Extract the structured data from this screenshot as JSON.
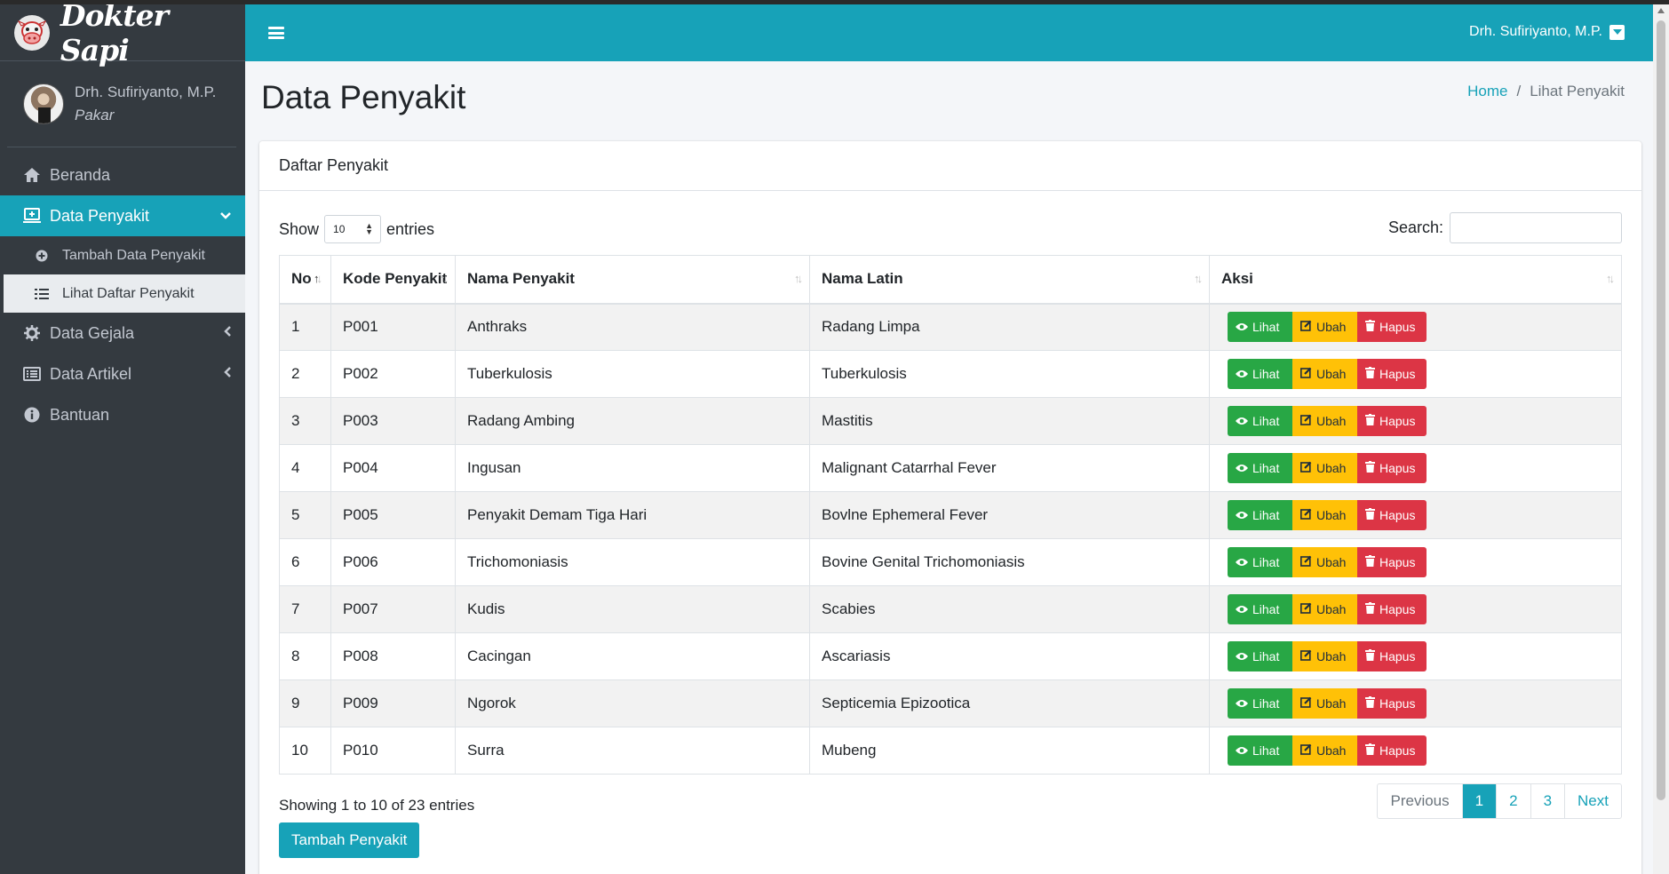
{
  "brand": {
    "name": "Dokter Sapi"
  },
  "user": {
    "name": "Drh. Sufiriyanto, M.P.",
    "role": "Pakar"
  },
  "sidebar": {
    "items": [
      {
        "label": "Beranda",
        "icon": "home-icon"
      },
      {
        "label": "Data Penyakit",
        "icon": "add-box-icon",
        "active": true
      },
      {
        "label": "Data Gejala",
        "icon": "gear-icon"
      },
      {
        "label": "Data Artikel",
        "icon": "list-alt-icon"
      },
      {
        "label": "Bantuan",
        "icon": "info-icon"
      }
    ],
    "sub_items": [
      {
        "label": "Tambah Data Penyakit",
        "icon": "plus-circle-icon"
      },
      {
        "label": "Lihat Daftar Penyakit",
        "icon": "list-icon",
        "current": true
      }
    ]
  },
  "header": {
    "user_label": "Drh. Sufiriyanto, M.P."
  },
  "page": {
    "title": "Data Penyakit",
    "breadcrumb": {
      "home": "Home",
      "sep": "/",
      "current": "Lihat Penyakit"
    }
  },
  "card": {
    "title": "Daftar Penyakit"
  },
  "controls": {
    "show": "Show",
    "entries_value": "10",
    "entries": "entries",
    "search_label": "Search:"
  },
  "table": {
    "columns": [
      "No",
      "Kode Penyakit",
      "Nama Penyakit",
      "Nama Latin",
      "Aksi"
    ],
    "rows": [
      [
        "1",
        "P001",
        "Anthraks",
        "Radang Limpa"
      ],
      [
        "2",
        "P002",
        "Tuberkulosis",
        "Tuberkulosis"
      ],
      [
        "3",
        "P003",
        "Radang Ambing",
        "Mastitis"
      ],
      [
        "4",
        "P004",
        "Ingusan",
        "Malignant Catarrhal Fever"
      ],
      [
        "5",
        "P005",
        "Penyakit Demam Tiga Hari",
        "Bovlne Ephemeral Fever"
      ],
      [
        "6",
        "P006",
        "Trichomoniasis",
        "Bovine Genital Trichomoniasis"
      ],
      [
        "7",
        "P007",
        "Kudis",
        "Scabies"
      ],
      [
        "8",
        "P008",
        "Cacingan",
        "Ascariasis"
      ],
      [
        "9",
        "P009",
        "Ngorok",
        "Septicemia Epizootica"
      ],
      [
        "10",
        "P010",
        "Surra",
        "Mubeng"
      ]
    ],
    "actions": {
      "view": "Lihat",
      "edit": "Ubah",
      "delete": "Hapus"
    }
  },
  "footer": {
    "info": "Showing 1 to 10 of 23 entries",
    "pager": [
      "Previous",
      "1",
      "2",
      "3",
      "Next"
    ],
    "current_page": "1",
    "add_button": "Tambah Penyakit"
  },
  "colors": {
    "accent": "#17a2b8",
    "sidebar": "#343a40",
    "success": "#28a745",
    "warning": "#ffc107",
    "danger": "#dc3545"
  }
}
